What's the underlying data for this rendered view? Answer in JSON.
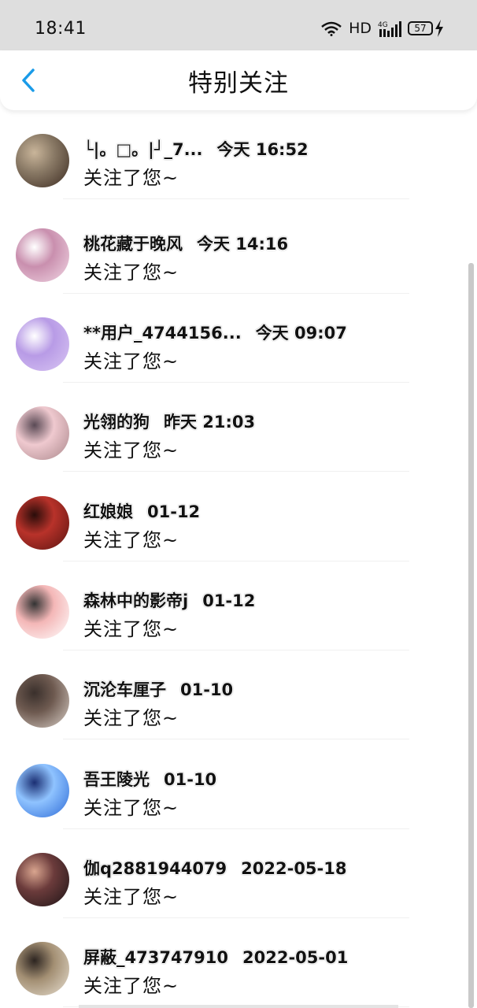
{
  "status_bar": {
    "time": "18:41",
    "network_label": "HD",
    "signal_label": "4G",
    "battery_level": "57"
  },
  "header": {
    "title": "特别关注",
    "back_icon": "chevron-left-icon",
    "back_color": "#1a9be8"
  },
  "list": {
    "items": [
      {
        "name": "└|。□。|┘_7...",
        "time": "今天 16:52",
        "message": "关注了您~",
        "avatar_colors": [
          "#3b2a20",
          "#8a7a66",
          "#c9b59a"
        ]
      },
      {
        "name": "桃花藏于晚风",
        "time": "今天 14:16",
        "message": "关注了您~",
        "avatar_colors": [
          "#f1d7e4",
          "#c98fae",
          "#ffffff"
        ]
      },
      {
        "name": "**用户_4744156...",
        "time": "今天 09:07",
        "message": "关注了您~",
        "avatar_colors": [
          "#d9c6f3",
          "#b89be6",
          "#ffffff"
        ]
      },
      {
        "name": "光翎的狗",
        "time": "昨天 21:03",
        "message": "关注了您~",
        "avatar_colors": [
          "#a9868a",
          "#efc9cf",
          "#5a4a55"
        ]
      },
      {
        "name": "红娘娘",
        "time": "01-12",
        "message": "关注了您~",
        "avatar_colors": [
          "#5a1410",
          "#b8322a",
          "#2a0d0a"
        ]
      },
      {
        "name": "森林中的影帝j",
        "time": "01-12",
        "message": "关注了您~",
        "avatar_colors": [
          "#ffffff",
          "#f4b7b7",
          "#333333"
        ]
      },
      {
        "name": "沉沦车厘子",
        "time": "01-10",
        "message": "关注了您~",
        "avatar_colors": [
          "#d9cfc7",
          "#6e5a50",
          "#3a302c"
        ]
      },
      {
        "name": "吾王陵光",
        "time": "01-10",
        "message": "关注了您~",
        "avatar_colors": [
          "#2d6ad6",
          "#8fc3ff",
          "#1b2f73"
        ]
      },
      {
        "name": "伽q2881944079",
        "time": "2022-05-18",
        "message": "关注了您~",
        "avatar_colors": [
          "#1c1416",
          "#6b3b3b",
          "#d9a58f"
        ]
      },
      {
        "name": "屏蔽_473747910",
        "time": "2022-05-01",
        "message": "关注了您~",
        "avatar_colors": [
          "#e8e0d2",
          "#a38f73",
          "#2c2420"
        ]
      }
    ]
  }
}
